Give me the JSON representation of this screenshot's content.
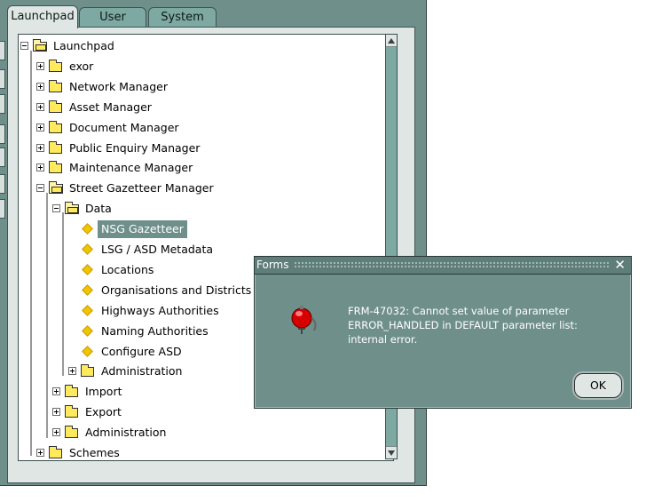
{
  "tabs": [
    {
      "label": "Launchpad",
      "active": true
    },
    {
      "label": "User",
      "active": false
    },
    {
      "label": "System",
      "active": false
    }
  ],
  "tree": [
    {
      "label": "Launchpad",
      "level": 0,
      "type": "folder-open",
      "expanded": true
    },
    {
      "label": "exor",
      "level": 1,
      "type": "folder",
      "expanded": false
    },
    {
      "label": "Network Manager",
      "level": 1,
      "type": "folder",
      "expanded": false
    },
    {
      "label": "Asset Manager",
      "level": 1,
      "type": "folder",
      "expanded": false
    },
    {
      "label": "Document Manager",
      "level": 1,
      "type": "folder",
      "expanded": false
    },
    {
      "label": "Public Enquiry Manager",
      "level": 1,
      "type": "folder",
      "expanded": false
    },
    {
      "label": "Maintenance Manager",
      "level": 1,
      "type": "folder",
      "expanded": false
    },
    {
      "label": "Street Gazetteer Manager",
      "level": 1,
      "type": "folder-open",
      "expanded": true
    },
    {
      "label": "Data",
      "level": 2,
      "type": "folder-open",
      "expanded": true
    },
    {
      "label": "NSG Gazetteer",
      "level": 3,
      "type": "leaf",
      "selected": true
    },
    {
      "label": "LSG / ASD Metadata",
      "level": 3,
      "type": "leaf"
    },
    {
      "label": "Locations",
      "level": 3,
      "type": "leaf"
    },
    {
      "label": "Organisations and Districts",
      "level": 3,
      "type": "leaf"
    },
    {
      "label": "Highways Authorities",
      "level": 3,
      "type": "leaf"
    },
    {
      "label": "Naming Authorities",
      "level": 3,
      "type": "leaf"
    },
    {
      "label": "Configure ASD",
      "level": 3,
      "type": "leaf"
    },
    {
      "label": "Administration",
      "level": 3,
      "type": "folder",
      "expanded": false
    },
    {
      "label": "Import",
      "level": 2,
      "type": "folder",
      "expanded": false
    },
    {
      "label": "Export",
      "level": 2,
      "type": "folder",
      "expanded": false
    },
    {
      "label": "Administration",
      "level": 2,
      "type": "folder",
      "expanded": false
    },
    {
      "label": "Schemes",
      "level": 1,
      "type": "folder",
      "expanded": false
    }
  ],
  "dialog": {
    "title": "Forms",
    "close_label": "✕",
    "message": "FRM-47032: Cannot set value of parameter ERROR_HANDLED in DEFAULT parameter list: internal error.",
    "ok_label": "OK",
    "icon": "alarm-bell-icon"
  },
  "colors": {
    "window": "#6f8f8b",
    "panel": "#dfe6e4",
    "selection": "#6f8f8b",
    "folder": "#ffe95c",
    "leaf": "#f1c400"
  }
}
